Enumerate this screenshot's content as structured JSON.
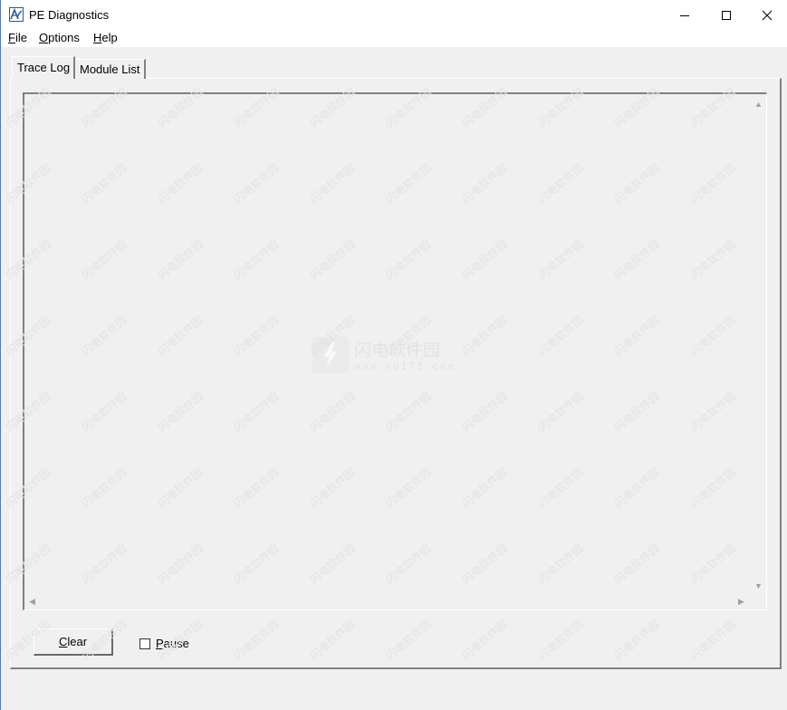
{
  "window": {
    "title": "PE Diagnostics",
    "icon": "app-icon"
  },
  "menu": [
    {
      "accel": "F",
      "rest": "ile"
    },
    {
      "accel": "O",
      "rest": "ptions"
    },
    {
      "accel": "H",
      "rest": "elp"
    }
  ],
  "tabs": [
    {
      "label": "Trace Log",
      "active": true
    },
    {
      "label": "Module List",
      "active": false
    }
  ],
  "controls": {
    "clear": {
      "accel": "C",
      "rest": "lear"
    },
    "pause": {
      "accel": "P",
      "rest": "ause",
      "checked": false
    }
  },
  "watermark": {
    "title": "闪电软件园",
    "url": "www.sd173.com",
    "tile_text": "闪电软件园"
  },
  "colors": {
    "background": "#f0f0f0",
    "titlebar": "#ffffff",
    "shadow": "#808080"
  }
}
